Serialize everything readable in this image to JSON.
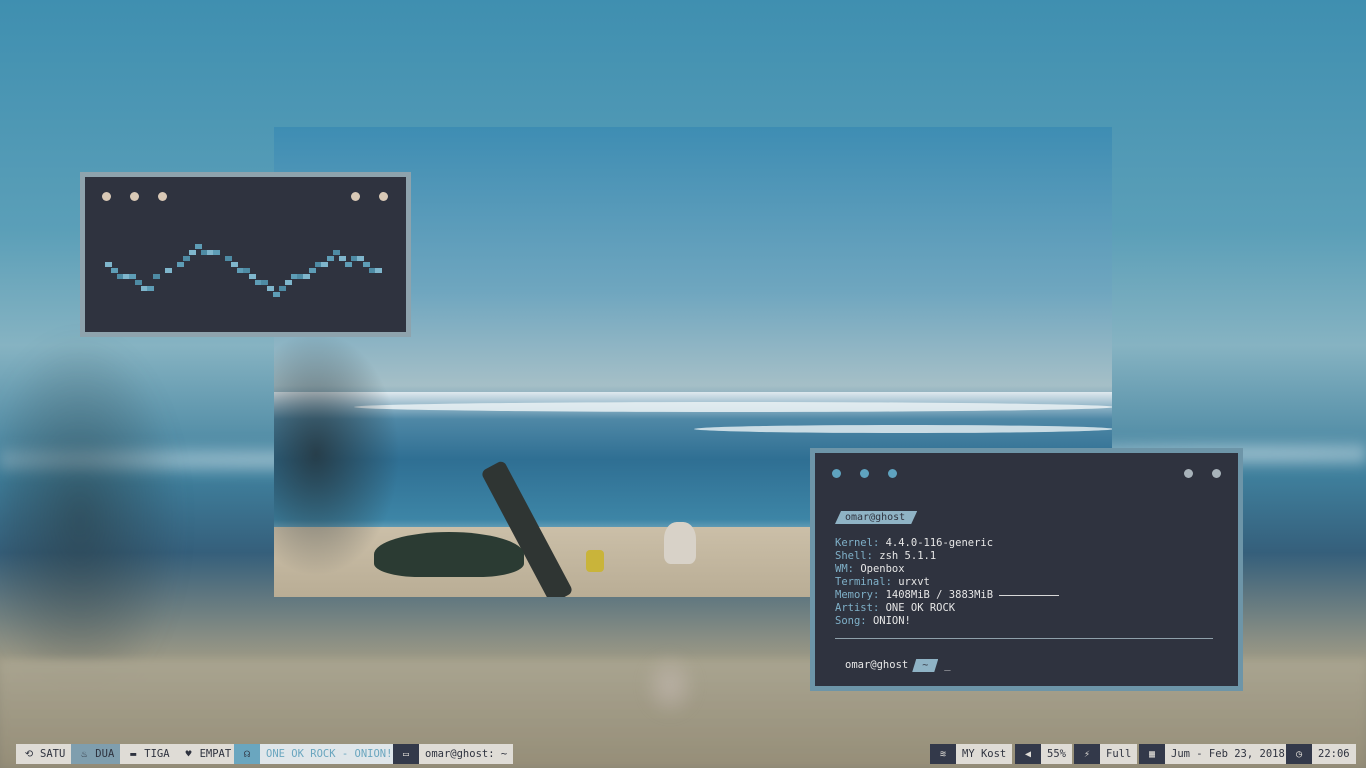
{
  "workspaces": [
    {
      "label": "SATU",
      "icon": "refresh-icon",
      "glyph": "⟲"
    },
    {
      "label": "DUA",
      "icon": "fire-icon",
      "glyph": "♨"
    },
    {
      "label": "TIGA",
      "icon": "folder-icon",
      "glyph": "▬"
    },
    {
      "label": "EMPAT",
      "icon": "heartbeat-icon",
      "glyph": "♥"
    }
  ],
  "music": {
    "icon": "headphones-icon",
    "glyph": "☊",
    "text": "ONE OK ROCK - ONION!"
  },
  "window_title": {
    "icon": "monitor-icon",
    "glyph": "▭",
    "text": "omar@ghost: ~"
  },
  "status": {
    "wifi": {
      "icon": "wifi-icon",
      "glyph": "≋",
      "text": "MY Kost"
    },
    "volume": {
      "icon": "volume-icon",
      "glyph": "◀",
      "text": "55%"
    },
    "battery": {
      "icon": "plug-icon",
      "glyph": "⚡",
      "text": "Full"
    },
    "date": {
      "icon": "calendar-icon",
      "glyph": "▦",
      "text": "Jum - Feb 23, 2018"
    },
    "time": {
      "icon": "clock-icon",
      "glyph": "◷",
      "text": "22:06"
    }
  },
  "terminal": {
    "user_tag": "omar@ghost",
    "info": [
      {
        "key": "Kernel",
        "value": "4.4.0-116-generic"
      },
      {
        "key": "Shell",
        "value": "zsh 5.1.1"
      },
      {
        "key": "WM",
        "value": "Openbox"
      },
      {
        "key": "Terminal",
        "value": "urxvt"
      },
      {
        "key": "Memory",
        "value": "1408MiB / 3883MiB"
      },
      {
        "key": "Artist",
        "value": "ONE OK ROCK"
      },
      {
        "key": "Song",
        "value": "ONION!"
      }
    ],
    "prompt_user": "omar@ghost",
    "prompt_dir": "~",
    "cursor": "_"
  },
  "colors": {
    "panel": "#2f333f",
    "accent": "#6aa6bf",
    "bar_light": "#dfdcd6"
  }
}
